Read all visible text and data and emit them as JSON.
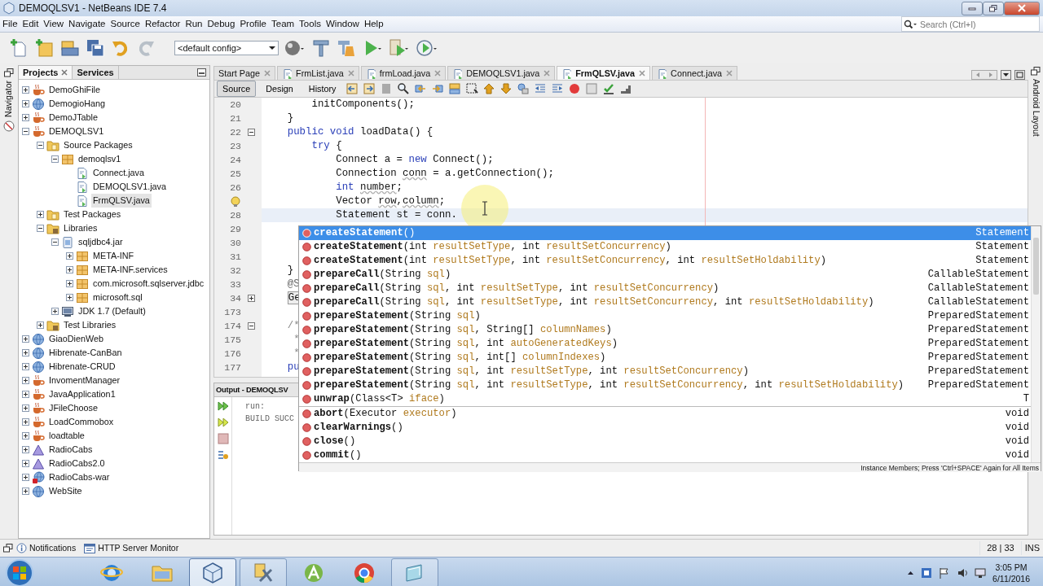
{
  "window": {
    "title": "DEMOQLSV1 - NetBeans IDE 7.4"
  },
  "menu": [
    "File",
    "Edit",
    "View",
    "Navigate",
    "Source",
    "Refactor",
    "Run",
    "Debug",
    "Profile",
    "Team",
    "Tools",
    "Window",
    "Help"
  ],
  "search": {
    "placeholder": "Search (Ctrl+I)"
  },
  "toolbar": {
    "config": "<default config>"
  },
  "navigator": {
    "label": "Navigator"
  },
  "projects": {
    "tabs": [
      {
        "label": "Projects",
        "selected": true
      },
      {
        "label": "Services",
        "selected": false
      }
    ],
    "tree": [
      {
        "label": "DemoGhiFile",
        "kind": "java",
        "expanded": false,
        "selected": false
      },
      {
        "label": "DemogioHang",
        "kind": "web",
        "expanded": false,
        "selected": false
      },
      {
        "label": "DemoJTable",
        "kind": "java",
        "expanded": false,
        "selected": false
      },
      {
        "label": "DEMOQLSV1",
        "kind": "java",
        "expanded": true,
        "selected": false,
        "children": [
          {
            "label": "Source Packages",
            "kind": "folder",
            "expanded": true,
            "selected": false,
            "children": [
              {
                "label": "demoqlsv1",
                "kind": "package",
                "expanded": true,
                "selected": false,
                "children": [
                  {
                    "label": "Connect.java",
                    "kind": "file",
                    "selected": false
                  },
                  {
                    "label": "DEMOQLSV1.java",
                    "kind": "file",
                    "selected": false
                  },
                  {
                    "label": "FrmQLSV.java",
                    "kind": "file",
                    "selected": true
                  }
                ]
              }
            ]
          },
          {
            "label": "Test Packages",
            "kind": "folder",
            "expanded": false,
            "selected": false
          },
          {
            "label": "Libraries",
            "kind": "library",
            "expanded": true,
            "selected": false,
            "children": [
              {
                "label": "sqljdbc4.jar",
                "kind": "jar",
                "expanded": true,
                "selected": false,
                "children": [
                  {
                    "label": "META-INF",
                    "kind": "package",
                    "expanded": false,
                    "selected": false
                  },
                  {
                    "label": "META-INF.services",
                    "kind": "package",
                    "expanded": false,
                    "selected": false
                  },
                  {
                    "label": "com.microsoft.sqlserver.jdbc",
                    "kind": "package",
                    "expanded": false,
                    "selected": false
                  },
                  {
                    "label": "microsoft.sql",
                    "kind": "package",
                    "expanded": false,
                    "selected": false
                  }
                ]
              },
              {
                "label": "JDK 1.7 (Default)",
                "kind": "jdk",
                "expanded": false,
                "selected": false
              }
            ]
          },
          {
            "label": "Test Libraries",
            "kind": "library",
            "expanded": false,
            "selected": false
          }
        ]
      },
      {
        "label": "GiaoDienWeb",
        "kind": "web",
        "expanded": false,
        "selected": false
      },
      {
        "label": "Hibrenate-CanBan",
        "kind": "web",
        "expanded": false,
        "selected": false
      },
      {
        "label": "Hibrenate-CRUD",
        "kind": "web",
        "expanded": false,
        "selected": false
      },
      {
        "label": "InvomentManager",
        "kind": "java",
        "expanded": false,
        "selected": false
      },
      {
        "label": "JavaApplication1",
        "kind": "java",
        "expanded": false,
        "selected": false
      },
      {
        "label": "JFileChoose",
        "kind": "java",
        "expanded": false,
        "selected": false
      },
      {
        "label": "LoadCommobox",
        "kind": "java",
        "expanded": false,
        "selected": false
      },
      {
        "label": "loadtable",
        "kind": "java",
        "expanded": false,
        "selected": false
      },
      {
        "label": "RadioCabs",
        "kind": "triangle",
        "expanded": false,
        "selected": false
      },
      {
        "label": "RadioCabs2.0",
        "kind": "triangle",
        "expanded": false,
        "selected": false
      },
      {
        "label": "RadioCabs-war",
        "kind": "web-error",
        "expanded": false,
        "selected": false
      },
      {
        "label": "WebSite",
        "kind": "web",
        "expanded": false,
        "selected": false
      }
    ]
  },
  "editor": {
    "tabs": [
      {
        "label": "Start Page",
        "selected": false
      },
      {
        "label": "FrmList.java",
        "selected": false
      },
      {
        "label": "frmLoad.java",
        "selected": false
      },
      {
        "label": "DEMOQLSV1.java",
        "selected": false
      },
      {
        "label": "FrmQLSV.java",
        "selected": true
      },
      {
        "label": "Connect.java",
        "selected": false
      }
    ],
    "views": [
      {
        "label": "Source",
        "selected": true
      },
      {
        "label": "Design",
        "selected": false
      },
      {
        "label": "History",
        "selected": false
      }
    ],
    "lines": [
      {
        "number": "20",
        "code": [
          {
            "text": "        initComponents();",
            "kind": "plain"
          }
        ]
      },
      {
        "number": "21",
        "code": [
          {
            "text": "    }",
            "kind": "plain"
          }
        ]
      },
      {
        "number": "22",
        "collapsed": false,
        "code": [
          {
            "text": "    public void",
            "kind": "keyword"
          },
          {
            "text": " loadData() {",
            "kind": "plain"
          }
        ]
      },
      {
        "number": "23",
        "code": [
          {
            "text": "        try",
            "kind": "keyword"
          },
          {
            "text": " {",
            "kind": "plain"
          }
        ]
      },
      {
        "number": "24",
        "code": [
          {
            "text": "            Connect a = ",
            "kind": "plain"
          },
          {
            "text": "new",
            "kind": "keyword"
          },
          {
            "text": " Connect();",
            "kind": "plain"
          }
        ]
      },
      {
        "number": "25",
        "code": [
          {
            "text": "            Connection ",
            "kind": "plain"
          },
          {
            "text": "conn",
            "kind": "warned"
          },
          {
            "text": " = a.getConnection();",
            "kind": "plain"
          }
        ]
      },
      {
        "number": "26",
        "code": [
          {
            "text": "            int ",
            "kind": "keyword"
          },
          {
            "text": "number",
            "kind": "warned"
          },
          {
            "text": ";",
            "kind": "plain"
          }
        ]
      },
      {
        "warning": true,
        "code": [
          {
            "text": "            Vector ",
            "kind": "plain"
          },
          {
            "text": "row",
            "kind": "warned"
          },
          {
            "text": ",",
            "kind": "plain"
          },
          {
            "text": "column",
            "kind": "warned"
          },
          {
            "text": ";",
            "kind": "plain"
          }
        ]
      },
      {
        "number": "28",
        "current": true,
        "code": [
          {
            "text": "            Statement st = conn.",
            "kind": "plain"
          }
        ]
      },
      {
        "number": "29"
      },
      {
        "number": "30"
      },
      {
        "number": "31"
      },
      {
        "number": "32",
        "code": [
          {
            "text": "    }",
            "kind": "plain"
          }
        ]
      },
      {
        "number": "33",
        "code": [
          {
            "text": "    @S",
            "kind": "annotation"
          }
        ]
      },
      {
        "number": "34",
        "collapsed": true,
        "code": [
          {
            "text": "    Ge",
            "kind": "folded"
          }
        ]
      },
      {
        "number": "173"
      },
      {
        "number": "174",
        "collapsed": false,
        "code": [
          {
            "text": "    /*",
            "kind": "comment"
          }
        ]
      },
      {
        "number": "175",
        "code": [
          {
            "text": "     *",
            "kind": "comment"
          }
        ]
      },
      {
        "number": "176",
        "code": [
          {
            "text": "     *",
            "kind": "comment"
          }
        ]
      },
      {
        "number": "177",
        "code": [
          {
            "text": "    pu",
            "kind": "keyword"
          }
        ]
      }
    ]
  },
  "completion": {
    "sections": [
      {
        "items": [
          {
            "signature": "createStatement()",
            "returns": "Statement",
            "selected": true
          },
          {
            "signature": "createStatement(int resultSetType, int resultSetConcurrency)",
            "returns": "Statement",
            "selected": false
          },
          {
            "signature": "createStatement(int resultSetType, int resultSetConcurrency, int resultSetHoldability)",
            "returns": "Statement",
            "selected": false
          },
          {
            "signature": "prepareCall(String sql)",
            "returns": "CallableStatement",
            "selected": false
          },
          {
            "signature": "prepareCall(String sql, int resultSetType, int resultSetConcurrency)",
            "returns": "CallableStatement",
            "selected": false
          },
          {
            "signature": "prepareCall(String sql, int resultSetType, int resultSetConcurrency, int resultSetHoldability)",
            "returns": "CallableStatement",
            "selected": false
          },
          {
            "signature": "prepareStatement(String sql)",
            "returns": "PreparedStatement",
            "selected": false
          },
          {
            "signature": "prepareStatement(String sql, String[] columnNames)",
            "returns": "PreparedStatement",
            "selected": false
          },
          {
            "signature": "prepareStatement(String sql, int autoGeneratedKeys)",
            "returns": "PreparedStatement",
            "selected": false
          },
          {
            "signature": "prepareStatement(String sql, int[] columnIndexes)",
            "returns": "PreparedStatement",
            "selected": false
          },
          {
            "signature": "prepareStatement(String sql, int resultSetType, int resultSetConcurrency)",
            "returns": "PreparedStatement",
            "selected": false
          },
          {
            "signature": "prepareStatement(String sql, int resultSetType, int resultSetConcurrency, int resultSetHoldability)",
            "returns": "PreparedStatement",
            "selected": false
          },
          {
            "signature": "unwrap(Class<T> iface)",
            "returns": "T",
            "selected": false
          }
        ]
      },
      {
        "items": [
          {
            "signature": "abort(Executor executor)",
            "returns": "void",
            "selected": false
          },
          {
            "signature": "clearWarnings()",
            "returns": "void",
            "selected": false
          },
          {
            "signature": "close()",
            "returns": "void",
            "selected": false
          },
          {
            "signature": "commit()",
            "returns": "void",
            "selected": false
          }
        ]
      }
    ],
    "hint": "Instance Members; Press 'Ctrl+SPACE' Again for All Items"
  },
  "output": {
    "title": "Output - DEMOQLSV",
    "lines": [
      "run:",
      "BUILD SUCC"
    ]
  },
  "right_strip": {
    "label": "Android Layout"
  },
  "status_bar": {
    "items": [
      "Notifications",
      "HTTP Server Monitor"
    ],
    "position": "28 | 33",
    "mode": "INS"
  },
  "taskbar": {
    "apps": [
      {
        "kind": "browser",
        "running": false,
        "selected": false
      },
      {
        "kind": "folder",
        "running": false,
        "selected": false
      },
      {
        "kind": "cube",
        "running": true,
        "selected": true
      },
      {
        "kind": "tools",
        "running": true,
        "selected": false
      },
      {
        "kind": "android",
        "running": false,
        "selected": false
      },
      {
        "kind": "chrome",
        "running": false,
        "selected": false
      },
      {
        "kind": "window",
        "running": true,
        "selected": false
      }
    ],
    "time": "3:05 PM",
    "date": "6/11/2016"
  }
}
